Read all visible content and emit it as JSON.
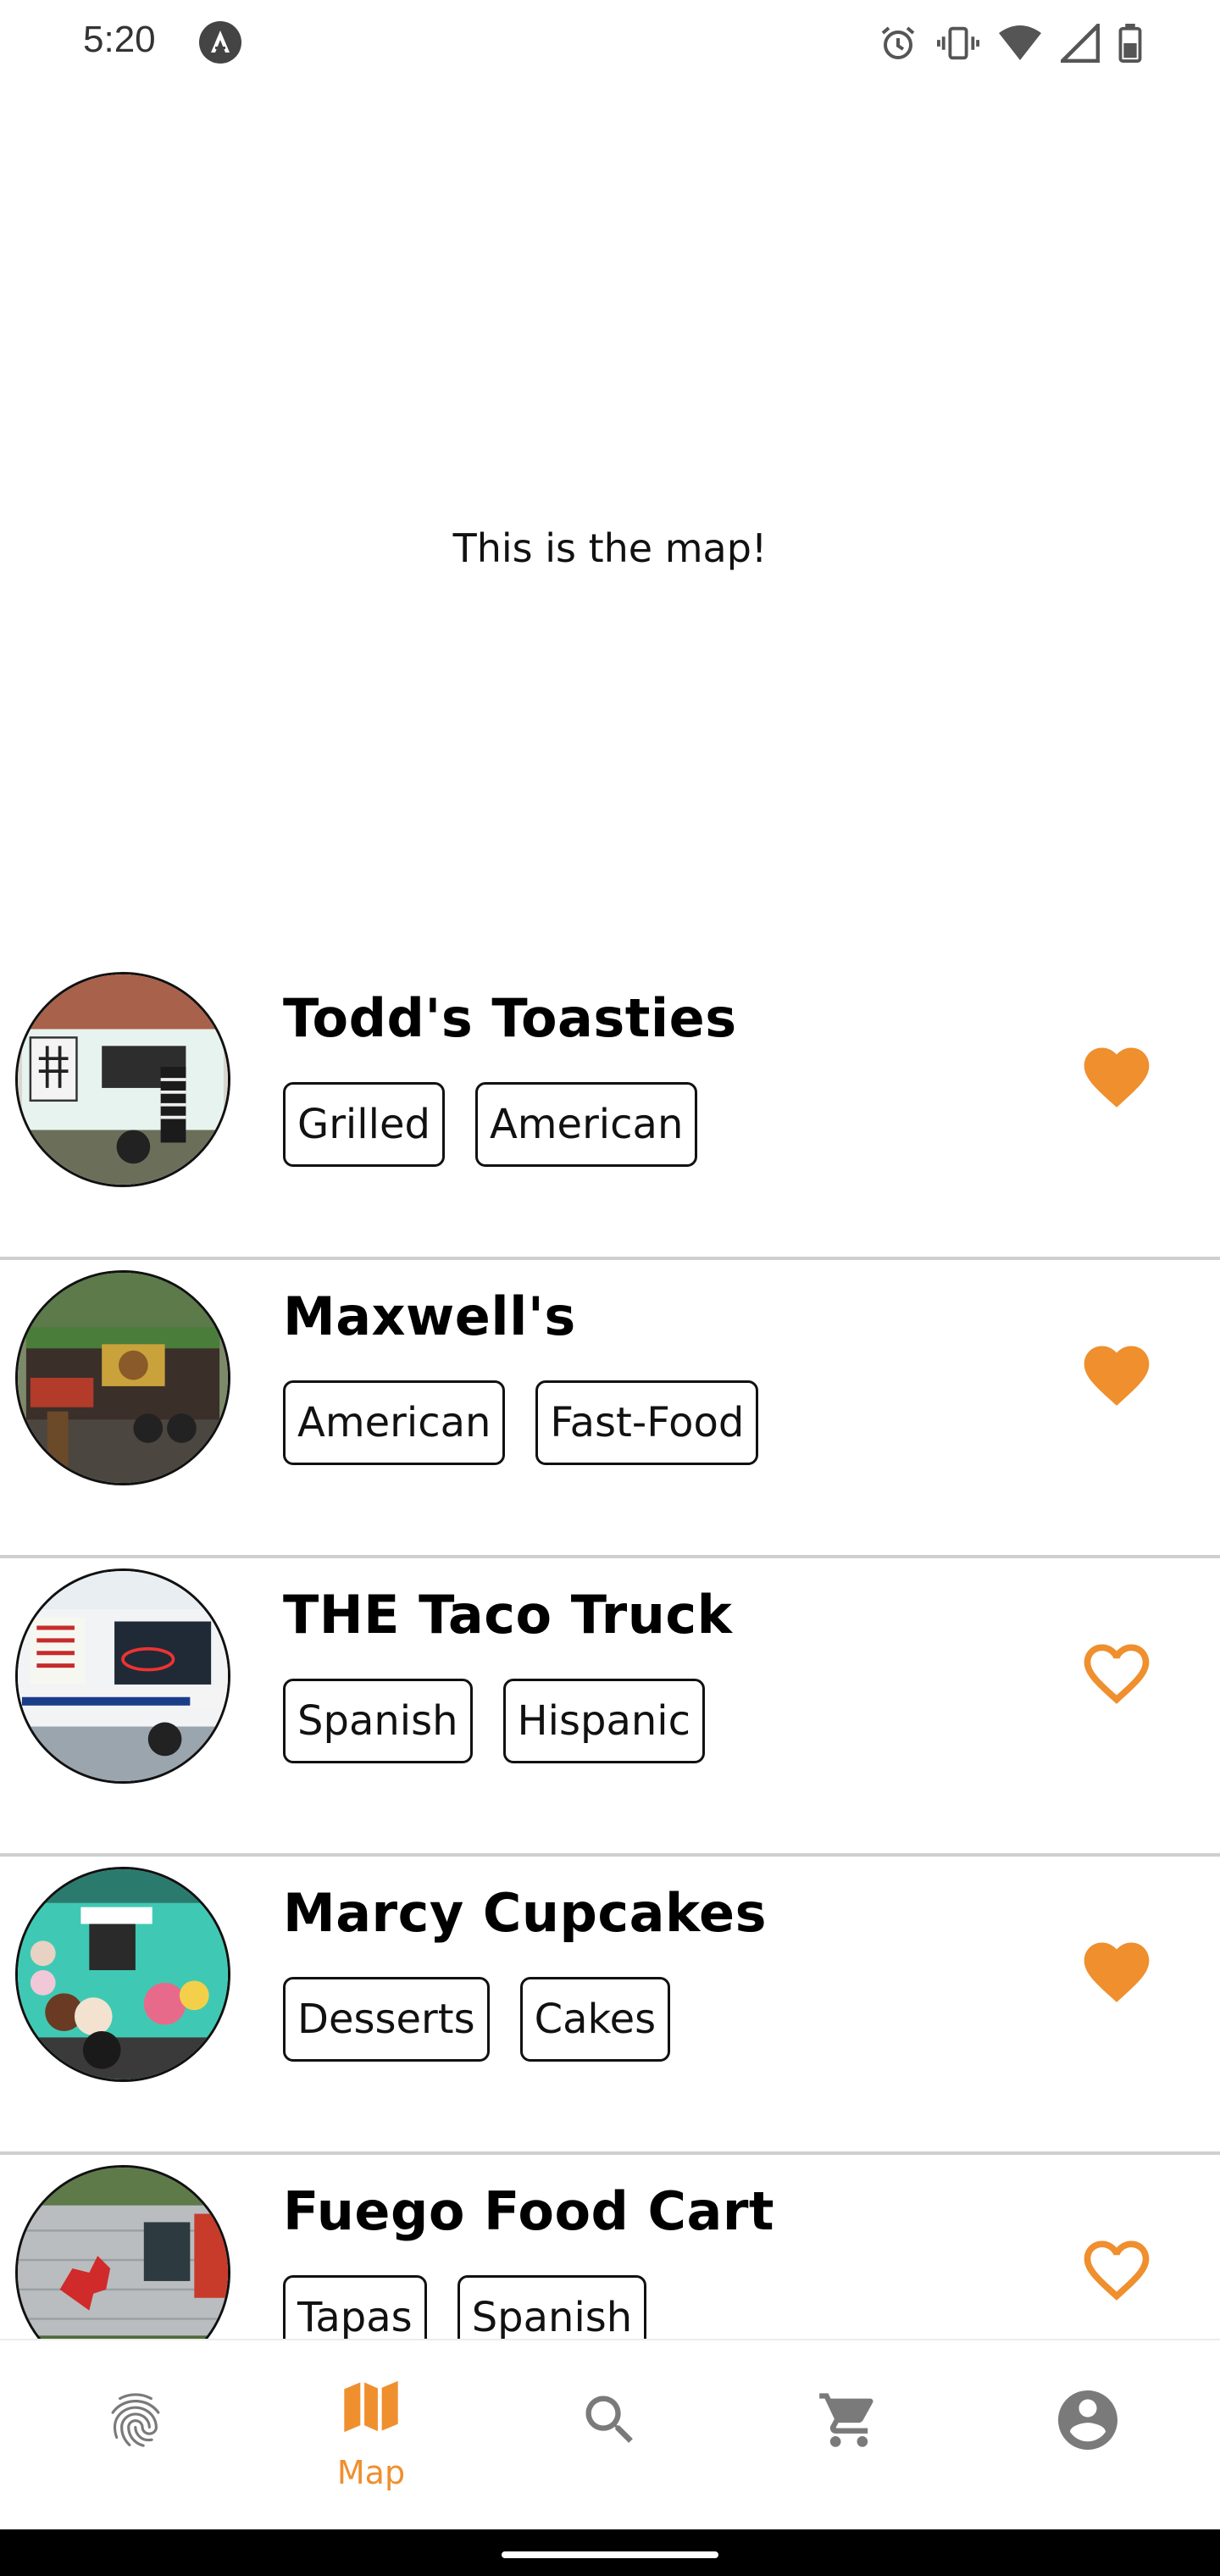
{
  "status": {
    "time": "5:20"
  },
  "map": {
    "placeholder_text": "This is the map!"
  },
  "colors": {
    "accent": "#ef8f2e",
    "icon_gray": "#7a7a7a",
    "divider": "#cfcfcf"
  },
  "trucks": [
    {
      "name": "Todd's Toasties",
      "tags": [
        "Grilled",
        "American"
      ],
      "favorite": true
    },
    {
      "name": "Maxwell's",
      "tags": [
        "American",
        "Fast-Food"
      ],
      "favorite": true
    },
    {
      "name": "THE Taco Truck",
      "tags": [
        "Spanish",
        "Hispanic"
      ],
      "favorite": false
    },
    {
      "name": "Marcy Cupcakes",
      "tags": [
        "Desserts",
        "Cakes"
      ],
      "favorite": true
    },
    {
      "name": "Fuego Food Cart",
      "tags": [
        "Tapas",
        "Spanish"
      ],
      "favorite": false
    }
  ],
  "nav": {
    "items": [
      {
        "icon": "fingerprint-icon",
        "label": "",
        "active": false
      },
      {
        "icon": "map-icon",
        "label": "Map",
        "active": true
      },
      {
        "icon": "search-icon",
        "label": "",
        "active": false
      },
      {
        "icon": "cart-icon",
        "label": "",
        "active": false
      },
      {
        "icon": "account-icon",
        "label": "",
        "active": false
      }
    ]
  }
}
